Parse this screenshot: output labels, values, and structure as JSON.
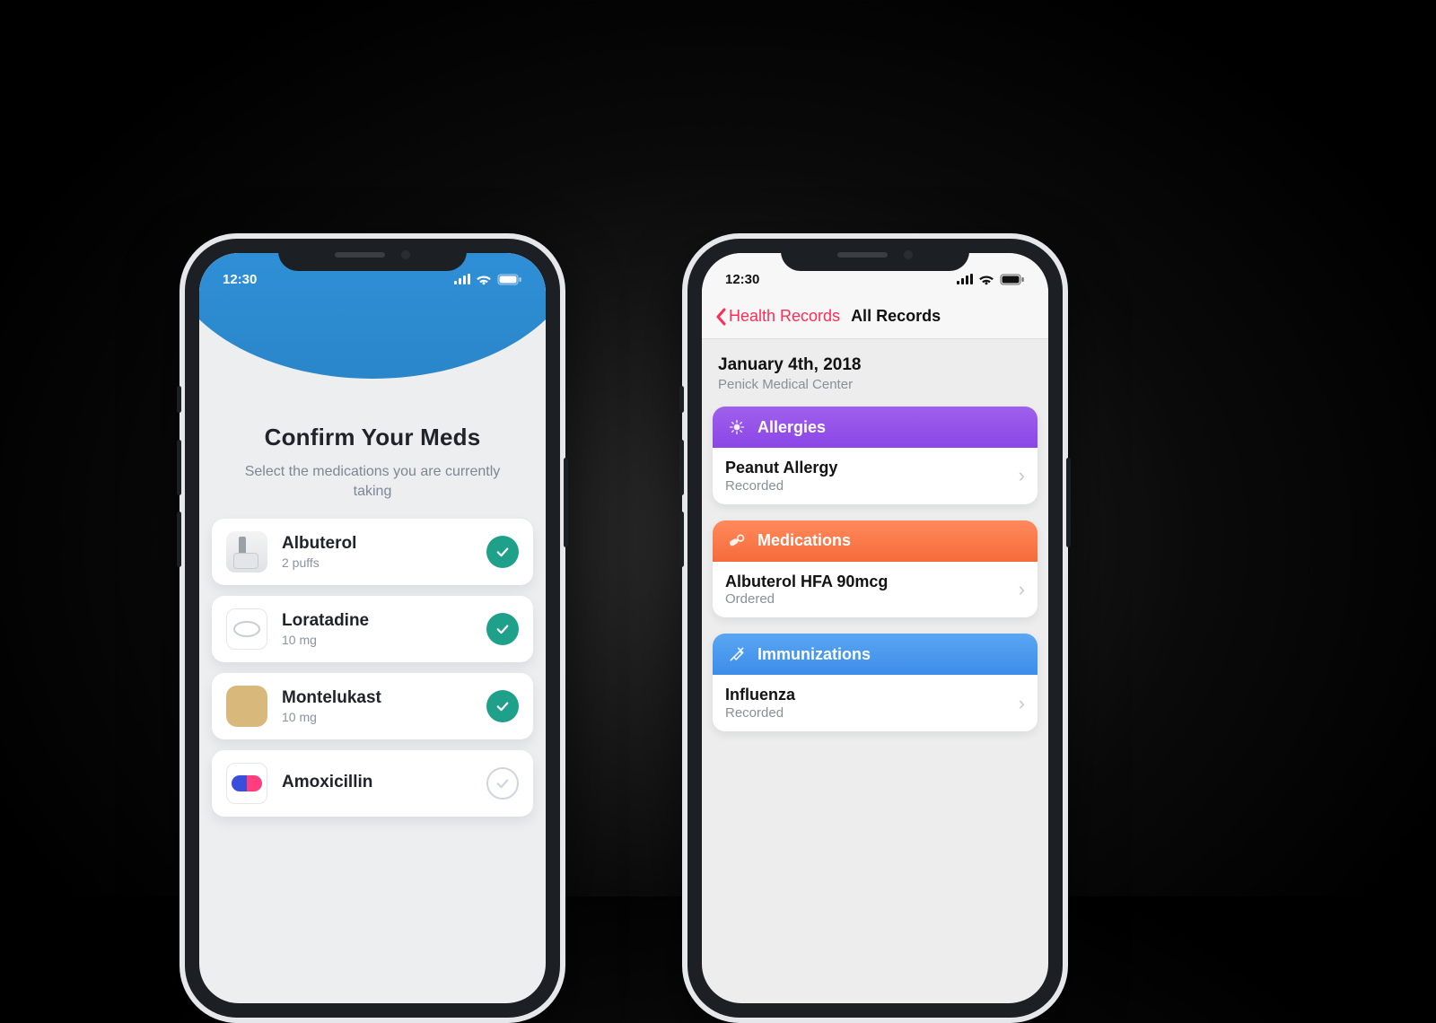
{
  "statusbar": {
    "time": "12:30"
  },
  "phone1": {
    "title": "Confirm Your Meds",
    "subtitle": "Select the medications you are currently taking",
    "meds": [
      {
        "name": "Albuterol",
        "dose": "2 puffs",
        "selected": true,
        "icon": "inhaler"
      },
      {
        "name": "Loratadine",
        "dose": "10 mg",
        "selected": true,
        "icon": "oval"
      },
      {
        "name": "Montelukast",
        "dose": "10 mg",
        "selected": true,
        "icon": "square"
      },
      {
        "name": "Amoxicillin",
        "dose": "",
        "selected": false,
        "icon": "capsule"
      }
    ]
  },
  "phone2": {
    "back_label": "Health Records",
    "page_title": "All Records",
    "date": "January 4th, 2018",
    "place": "Penick Medical Center",
    "sections": {
      "allergies": {
        "label": "Allergies",
        "item": "Peanut Allergy",
        "status": "Recorded"
      },
      "medications": {
        "label": "Medications",
        "item": "Albuterol HFA 90mcg",
        "status": "Ordered"
      },
      "immunizations": {
        "label": "Immunizations",
        "item": "Influenza",
        "status": "Recorded"
      }
    }
  },
  "colors": {
    "accent_blue": "#2f8fd6",
    "check_green": "#1ea08a",
    "ios_pink": "#ff2d55",
    "allergies": "#8b46e6",
    "medications": "#f66b3a",
    "immunizations": "#3d8de9"
  }
}
